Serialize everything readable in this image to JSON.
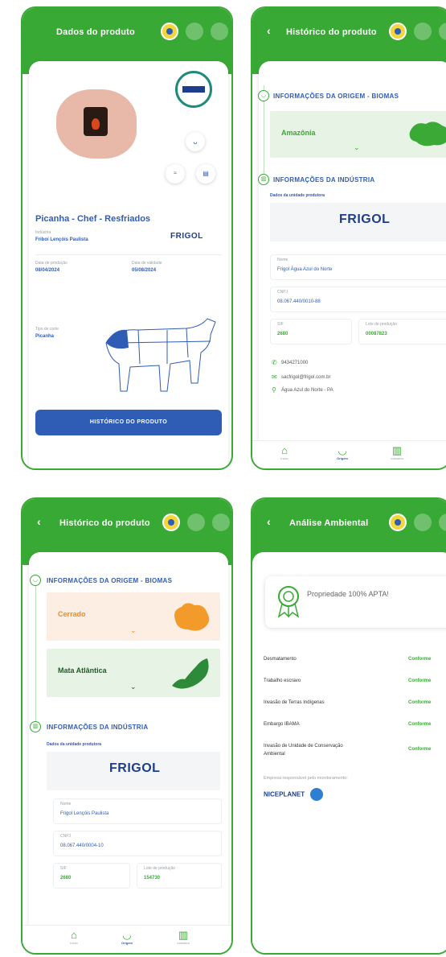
{
  "screens": {
    "produto": {
      "title": "Dados do produto",
      "product_name": "Picanha - Chef - Resfriados",
      "industria_label": "Indústria",
      "industria_value": "Friboi Lençóis Paulista",
      "producao_label": "Data de produção",
      "producao_value": "08/04/2024",
      "validade_label": "Data de validade",
      "validade_value": "05/08/2024",
      "corte_label": "Tipo de corte",
      "corte_value": "Picanha",
      "button_label": "HISTÓRICO DO PRODUTO",
      "brand": "FRIGOL"
    },
    "historico1": {
      "title": "Histórico do produto",
      "origem_title": "INFORMAÇÕES DA ORIGEM - BIOMAS",
      "biome1": "Amazônia",
      "industria_title": "INFORMAÇÕES DA INDÚSTRIA",
      "dados_label": "Dados da unidade produtora",
      "brand": "FRIGOL",
      "nome_label": "Nome",
      "nome_value": "Frigol Água Azul do Norte",
      "cnpj_label": "CNPJ",
      "cnpj_value": "08.067.440/0010-88",
      "sif_label": "SIF",
      "sif_value": "2680",
      "lote_label": "Lote de produção",
      "lote_value": "00087823",
      "phone": "9434271000",
      "email": "sacfrigol@frigol.com.br",
      "address": "Água Azul do Norte - PA"
    },
    "historico2": {
      "title": "Histórico do produto",
      "origem_title": "INFORMAÇÕES DA ORIGEM - BIOMAS",
      "biome1": "Cerrado",
      "biome2": "Mata Atlântica",
      "industria_title": "INFORMAÇÕES DA INDÚSTRIA",
      "dados_label": "Dados da unidade produtora",
      "brand": "FRIGOL",
      "nome_label": "Nome",
      "nome_value": "Frigol Lençóis Paulista",
      "cnpj_label": "CNPJ",
      "cnpj_value": "08.067.440/0004-10",
      "sif_label": "SIF",
      "sif_value": "2680",
      "lote_label": "Lote de produção",
      "lote_value": "154730"
    },
    "analise": {
      "title": "Análise Ambiental",
      "badge_text": "Propriedade 100% APTA!",
      "rows": [
        {
          "label": "Desmatamento",
          "status": "Conforme"
        },
        {
          "label": "Trabalho escravo",
          "status": "Conforme"
        },
        {
          "label": "Invasão de Terras Indígenas",
          "status": "Conforme"
        },
        {
          "label": "Embargo IBAMA",
          "status": "Conforme"
        },
        {
          "label": "Invasão de Unidade de Conservação Ambiental",
          "status": "Conforme"
        }
      ],
      "empresa_label": "Empresa responsável pelo monitoramento:",
      "empresa_value": "NICEPLANET"
    }
  },
  "nav": {
    "inicio": "Início",
    "origem": "Origem",
    "industria": "Indústria"
  },
  "colors": {
    "green": "#39a935",
    "blue": "#2f5cb5",
    "cerrado_bg": "#fdeee3",
    "mata_bg": "#e6f3e5"
  }
}
